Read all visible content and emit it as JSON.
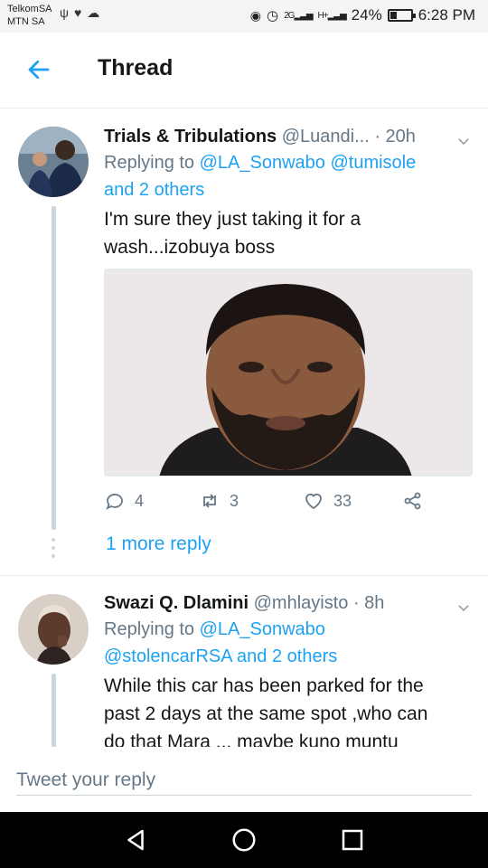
{
  "status_bar": {
    "carrier_1": "TelkomSA",
    "carrier_2": "MTN SA",
    "battery": "24%",
    "time": "6:28 PM",
    "net_1": "2G",
    "net_2": "H+"
  },
  "header": {
    "title": "Thread"
  },
  "tweets": [
    {
      "name": "Trials & Tribulations",
      "handle": "@Luandi...",
      "time": "· 20h",
      "replying_prefix": "Replying to",
      "replying_users": "@LA_Sonwabo @tumisole",
      "replying_others": "and 2 others",
      "text_line1": "I'm sure they just taking it for a",
      "text_line2": "wash...izobuya boss",
      "replies": "4",
      "retweets": "3",
      "likes": "33"
    },
    {
      "name": "Swazi Q. Dlamini",
      "handle": "@mhlayisto",
      "time": "· 8h",
      "replying_prefix": "Replying to",
      "replying_users": "@LA_Sonwabo",
      "replying_line2": "@stolencarRSA and 2 others",
      "text_line1": "While this car has been parked for the",
      "text_line2": "past 2 days at the same spot ,who can",
      "text_line3": "do that Mara ... maybe kuno muntu"
    }
  ],
  "more_reply": "1 more reply",
  "composer": {
    "placeholder": "Tweet your reply"
  },
  "colors": {
    "accent": "#1da1f2",
    "secondary_text": "#657786"
  }
}
